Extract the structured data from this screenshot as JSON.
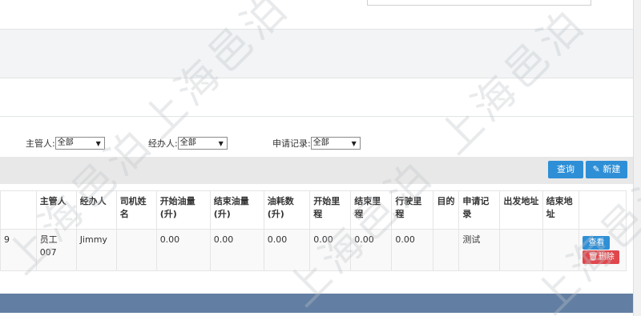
{
  "filters": [
    {
      "label": "主管人:",
      "value": "全部"
    },
    {
      "label": "经办人:",
      "value": "全部"
    },
    {
      "label": "申请记录:",
      "value": "全部"
    }
  ],
  "toolbar": {
    "query_label": "查询",
    "new_label": "新建"
  },
  "table": {
    "headers": [
      "",
      "主管人",
      "经办人",
      "司机姓名",
      "开始油量(升)",
      "结束油量(升)",
      "油耗数(升)",
      "开始里程",
      "结束里程",
      "行驶里程",
      "目的",
      "申请记录",
      "出发地址",
      "结束地址",
      ""
    ],
    "rows": [
      {
        "cells": [
          "9",
          "员工007",
          "Jimmy",
          "",
          "0.00",
          "0.00",
          "0.00",
          "0.00",
          "0.00",
          "0.00",
          "",
          "测试",
          "",
          ""
        ],
        "view_label": "查看",
        "delete_label": "删除"
      }
    ]
  },
  "watermark": "上海邑泊"
}
